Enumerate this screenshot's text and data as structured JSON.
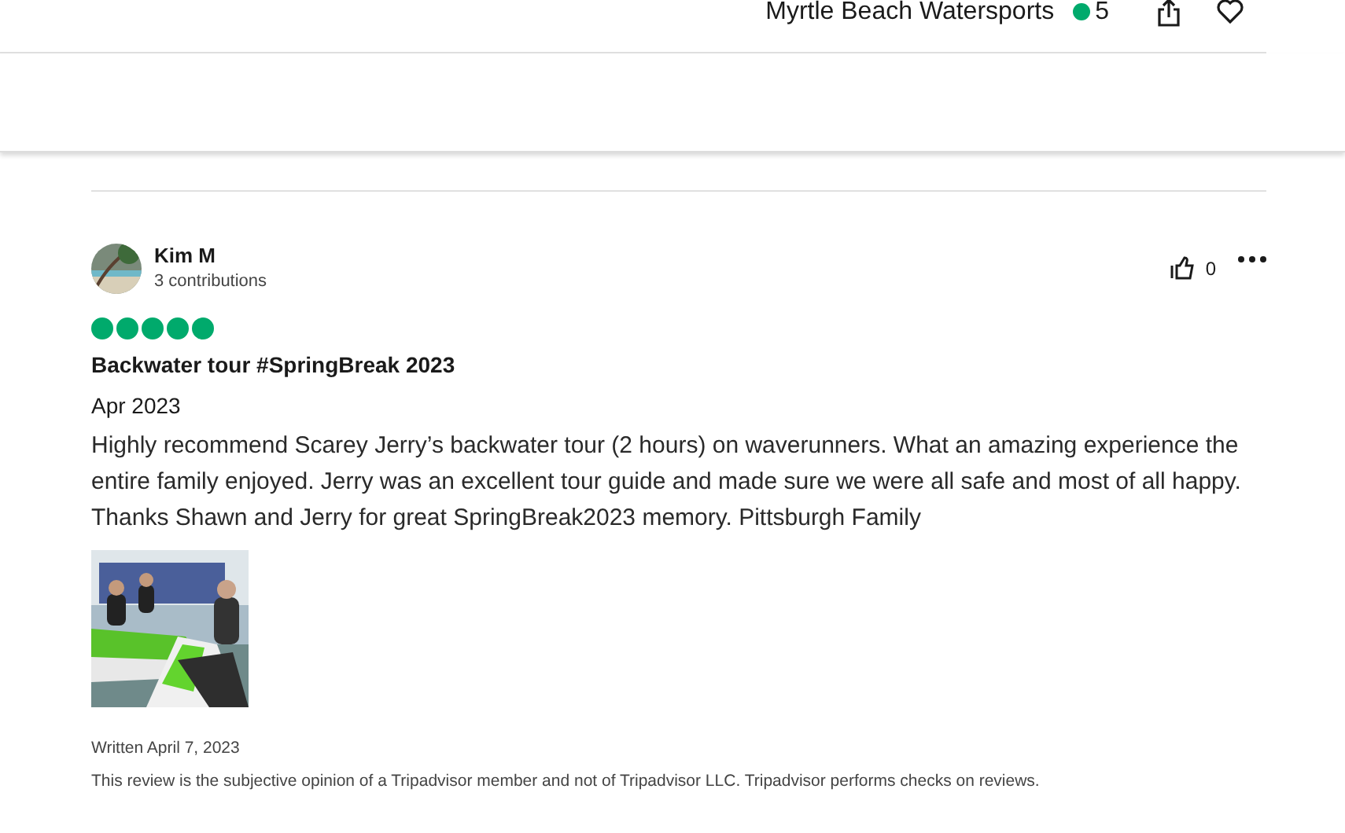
{
  "header": {
    "business_name": "Myrtle Beach Watersports",
    "rating_count": "5"
  },
  "review": {
    "author": "Kim M",
    "contributions": "3 contributions",
    "helpful_count": "0",
    "stars": 5,
    "title": "Backwater tour #SpringBreak 2023",
    "date": "Apr 2023",
    "body": "Highly recommend Scarey Jerry’s backwater tour (2 hours) on waverunners. What an amazing experience the entire family enjoyed. Jerry was an excellent tour guide and made sure we were all safe and most of all happy. Thanks Shawn and Jerry for great SpringBreak2023 memory. Pittsburgh Family",
    "photos": [
      {
        "kind": "picture"
      }
    ],
    "written": "Written April 7, 2023",
    "disclaimer": "This review is the subjective opinion of a Tripadvisor member and not of Tripadvisor LLC. Tripadvisor performs checks on reviews."
  }
}
